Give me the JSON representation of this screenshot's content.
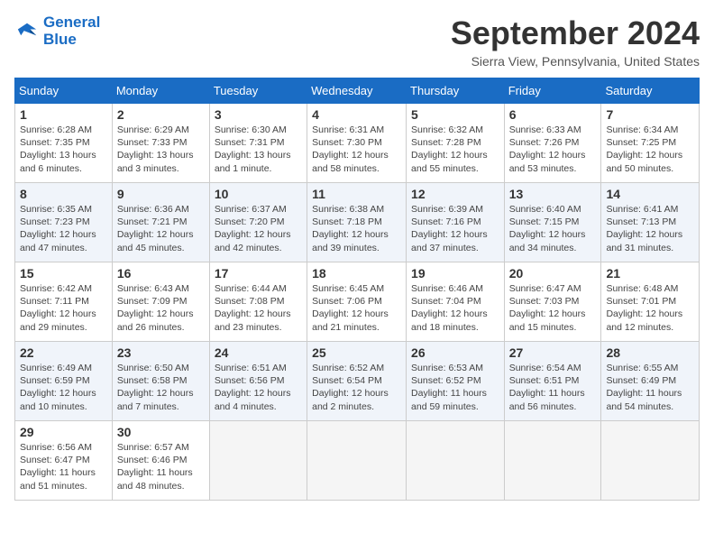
{
  "header": {
    "logo_line1": "General",
    "logo_line2": "Blue",
    "month": "September 2024",
    "location": "Sierra View, Pennsylvania, United States"
  },
  "weekdays": [
    "Sunday",
    "Monday",
    "Tuesday",
    "Wednesday",
    "Thursday",
    "Friday",
    "Saturday"
  ],
  "weeks": [
    [
      {
        "day": "1",
        "sunrise": "Sunrise: 6:28 AM",
        "sunset": "Sunset: 7:35 PM",
        "daylight": "Daylight: 13 hours and 6 minutes."
      },
      {
        "day": "2",
        "sunrise": "Sunrise: 6:29 AM",
        "sunset": "Sunset: 7:33 PM",
        "daylight": "Daylight: 13 hours and 3 minutes."
      },
      {
        "day": "3",
        "sunrise": "Sunrise: 6:30 AM",
        "sunset": "Sunset: 7:31 PM",
        "daylight": "Daylight: 13 hours and 1 minute."
      },
      {
        "day": "4",
        "sunrise": "Sunrise: 6:31 AM",
        "sunset": "Sunset: 7:30 PM",
        "daylight": "Daylight: 12 hours and 58 minutes."
      },
      {
        "day": "5",
        "sunrise": "Sunrise: 6:32 AM",
        "sunset": "Sunset: 7:28 PM",
        "daylight": "Daylight: 12 hours and 55 minutes."
      },
      {
        "day": "6",
        "sunrise": "Sunrise: 6:33 AM",
        "sunset": "Sunset: 7:26 PM",
        "daylight": "Daylight: 12 hours and 53 minutes."
      },
      {
        "day": "7",
        "sunrise": "Sunrise: 6:34 AM",
        "sunset": "Sunset: 7:25 PM",
        "daylight": "Daylight: 12 hours and 50 minutes."
      }
    ],
    [
      {
        "day": "8",
        "sunrise": "Sunrise: 6:35 AM",
        "sunset": "Sunset: 7:23 PM",
        "daylight": "Daylight: 12 hours and 47 minutes."
      },
      {
        "day": "9",
        "sunrise": "Sunrise: 6:36 AM",
        "sunset": "Sunset: 7:21 PM",
        "daylight": "Daylight: 12 hours and 45 minutes."
      },
      {
        "day": "10",
        "sunrise": "Sunrise: 6:37 AM",
        "sunset": "Sunset: 7:20 PM",
        "daylight": "Daylight: 12 hours and 42 minutes."
      },
      {
        "day": "11",
        "sunrise": "Sunrise: 6:38 AM",
        "sunset": "Sunset: 7:18 PM",
        "daylight": "Daylight: 12 hours and 39 minutes."
      },
      {
        "day": "12",
        "sunrise": "Sunrise: 6:39 AM",
        "sunset": "Sunset: 7:16 PM",
        "daylight": "Daylight: 12 hours and 37 minutes."
      },
      {
        "day": "13",
        "sunrise": "Sunrise: 6:40 AM",
        "sunset": "Sunset: 7:15 PM",
        "daylight": "Daylight: 12 hours and 34 minutes."
      },
      {
        "day": "14",
        "sunrise": "Sunrise: 6:41 AM",
        "sunset": "Sunset: 7:13 PM",
        "daylight": "Daylight: 12 hours and 31 minutes."
      }
    ],
    [
      {
        "day": "15",
        "sunrise": "Sunrise: 6:42 AM",
        "sunset": "Sunset: 7:11 PM",
        "daylight": "Daylight: 12 hours and 29 minutes."
      },
      {
        "day": "16",
        "sunrise": "Sunrise: 6:43 AM",
        "sunset": "Sunset: 7:09 PM",
        "daylight": "Daylight: 12 hours and 26 minutes."
      },
      {
        "day": "17",
        "sunrise": "Sunrise: 6:44 AM",
        "sunset": "Sunset: 7:08 PM",
        "daylight": "Daylight: 12 hours and 23 minutes."
      },
      {
        "day": "18",
        "sunrise": "Sunrise: 6:45 AM",
        "sunset": "Sunset: 7:06 PM",
        "daylight": "Daylight: 12 hours and 21 minutes."
      },
      {
        "day": "19",
        "sunrise": "Sunrise: 6:46 AM",
        "sunset": "Sunset: 7:04 PM",
        "daylight": "Daylight: 12 hours and 18 minutes."
      },
      {
        "day": "20",
        "sunrise": "Sunrise: 6:47 AM",
        "sunset": "Sunset: 7:03 PM",
        "daylight": "Daylight: 12 hours and 15 minutes."
      },
      {
        "day": "21",
        "sunrise": "Sunrise: 6:48 AM",
        "sunset": "Sunset: 7:01 PM",
        "daylight": "Daylight: 12 hours and 12 minutes."
      }
    ],
    [
      {
        "day": "22",
        "sunrise": "Sunrise: 6:49 AM",
        "sunset": "Sunset: 6:59 PM",
        "daylight": "Daylight: 12 hours and 10 minutes."
      },
      {
        "day": "23",
        "sunrise": "Sunrise: 6:50 AM",
        "sunset": "Sunset: 6:58 PM",
        "daylight": "Daylight: 12 hours and 7 minutes."
      },
      {
        "day": "24",
        "sunrise": "Sunrise: 6:51 AM",
        "sunset": "Sunset: 6:56 PM",
        "daylight": "Daylight: 12 hours and 4 minutes."
      },
      {
        "day": "25",
        "sunrise": "Sunrise: 6:52 AM",
        "sunset": "Sunset: 6:54 PM",
        "daylight": "Daylight: 12 hours and 2 minutes."
      },
      {
        "day": "26",
        "sunrise": "Sunrise: 6:53 AM",
        "sunset": "Sunset: 6:52 PM",
        "daylight": "Daylight: 11 hours and 59 minutes."
      },
      {
        "day": "27",
        "sunrise": "Sunrise: 6:54 AM",
        "sunset": "Sunset: 6:51 PM",
        "daylight": "Daylight: 11 hours and 56 minutes."
      },
      {
        "day": "28",
        "sunrise": "Sunrise: 6:55 AM",
        "sunset": "Sunset: 6:49 PM",
        "daylight": "Daylight: 11 hours and 54 minutes."
      }
    ],
    [
      {
        "day": "29",
        "sunrise": "Sunrise: 6:56 AM",
        "sunset": "Sunset: 6:47 PM",
        "daylight": "Daylight: 11 hours and 51 minutes."
      },
      {
        "day": "30",
        "sunrise": "Sunrise: 6:57 AM",
        "sunset": "Sunset: 6:46 PM",
        "daylight": "Daylight: 11 hours and 48 minutes."
      },
      null,
      null,
      null,
      null,
      null
    ]
  ]
}
